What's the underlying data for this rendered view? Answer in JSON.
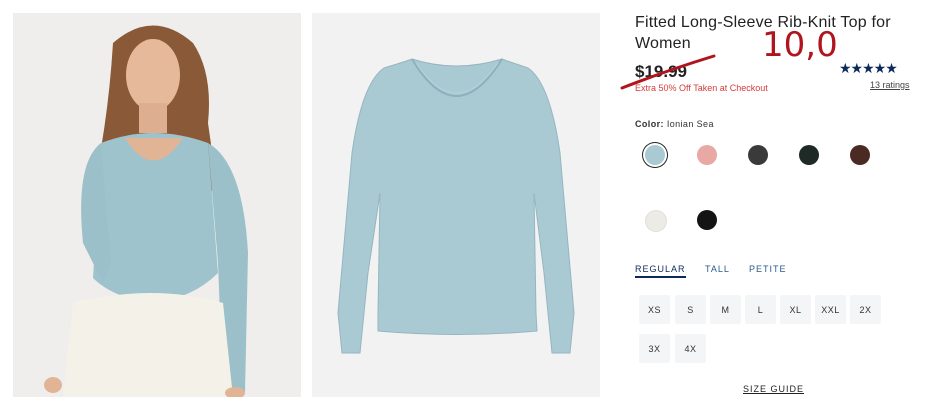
{
  "product": {
    "title": "Fitted Long-Sleeve Rib-Knit Top for Women",
    "handwritten_price": "10,0",
    "old_price": "$19.99",
    "discount_note": "Extra 50% Off Taken at Checkout",
    "rating_stars": "★★★★★",
    "rating_value": 5,
    "ratings_count_text": "13 ratings"
  },
  "color": {
    "label": "Color:",
    "selected_name": "Ionian Sea",
    "swatches": [
      {
        "name": "Ionian Sea",
        "hex": "#a9c9d3",
        "selected": true
      },
      {
        "name": "pink",
        "hex": "#e8a8a4",
        "selected": false
      },
      {
        "name": "dark gray",
        "hex": "#3a3a3a",
        "selected": false
      },
      {
        "name": "dark green",
        "hex": "#1f2a26",
        "selected": false
      },
      {
        "name": "brown",
        "hex": "#4a2a22",
        "selected": false
      },
      {
        "name": "cream",
        "hex": "#ecebe6",
        "selected": false
      },
      {
        "name": "black",
        "hex": "#141414",
        "selected": false
      }
    ]
  },
  "fit_tabs": [
    {
      "label": "REGULAR",
      "active": true
    },
    {
      "label": "TALL",
      "active": false
    },
    {
      "label": "PETITE",
      "active": false
    }
  ],
  "sizes": [
    "XS",
    "S",
    "M",
    "L",
    "XL",
    "XXL",
    "2X",
    "3X",
    "4X"
  ],
  "size_guide_label": "SIZE GUIDE",
  "colors": {
    "brand_navy": "#0b2a5b",
    "sale_red": "#d43c3c",
    "annotation_red": "#b0141c"
  }
}
